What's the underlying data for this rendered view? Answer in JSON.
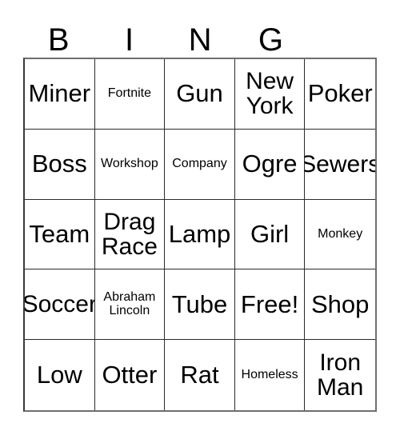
{
  "card": {
    "header": {
      "letters": [
        {
          "label": "B"
        },
        {
          "label": "I"
        },
        {
          "label": "N"
        },
        {
          "label": "G"
        },
        {
          "label": ""
        }
      ]
    },
    "rows": [
      {
        "cells": [
          {
            "label": "Miner",
            "size": "lg"
          },
          {
            "label": "Fortnite",
            "size": "sm"
          },
          {
            "label": "Gun",
            "size": "lg"
          },
          {
            "label": "New\nYork",
            "size": "wrap"
          },
          {
            "label": "Poker",
            "size": "lg"
          }
        ]
      },
      {
        "cells": [
          {
            "label": "Boss",
            "size": "lg"
          },
          {
            "label": "Workshop",
            "size": "sm"
          },
          {
            "label": "Company",
            "size": "sm"
          },
          {
            "label": "Ogre",
            "size": "lg"
          },
          {
            "label": "Sewers",
            "size": "md"
          }
        ]
      },
      {
        "cells": [
          {
            "label": "Team",
            "size": "lg"
          },
          {
            "label": "Drag\nRace",
            "size": "wrap"
          },
          {
            "label": "Lamp",
            "size": "lg"
          },
          {
            "label": "Girl",
            "size": "lg"
          },
          {
            "label": "Monkey",
            "size": "sm"
          }
        ]
      },
      {
        "cells": [
          {
            "label": "Soccer",
            "size": "md"
          },
          {
            "label": "Abraham\nLincoln",
            "size": "sm"
          },
          {
            "label": "Tube",
            "size": "lg"
          },
          {
            "label": "Free!",
            "size": "lg"
          },
          {
            "label": "Shop",
            "size": "lg"
          }
        ]
      },
      {
        "cells": [
          {
            "label": "Low",
            "size": "lg"
          },
          {
            "label": "Otter",
            "size": "lg"
          },
          {
            "label": "Rat",
            "size": "lg"
          },
          {
            "label": "Homeless",
            "size": "sm"
          },
          {
            "label": "Iron\nMan",
            "size": "wrap"
          }
        ]
      }
    ]
  },
  "colors": {
    "background": "#ffffff",
    "text": "#000000",
    "grid_line": "#2b2b2b",
    "grid_outer": "#6e6e6e"
  }
}
